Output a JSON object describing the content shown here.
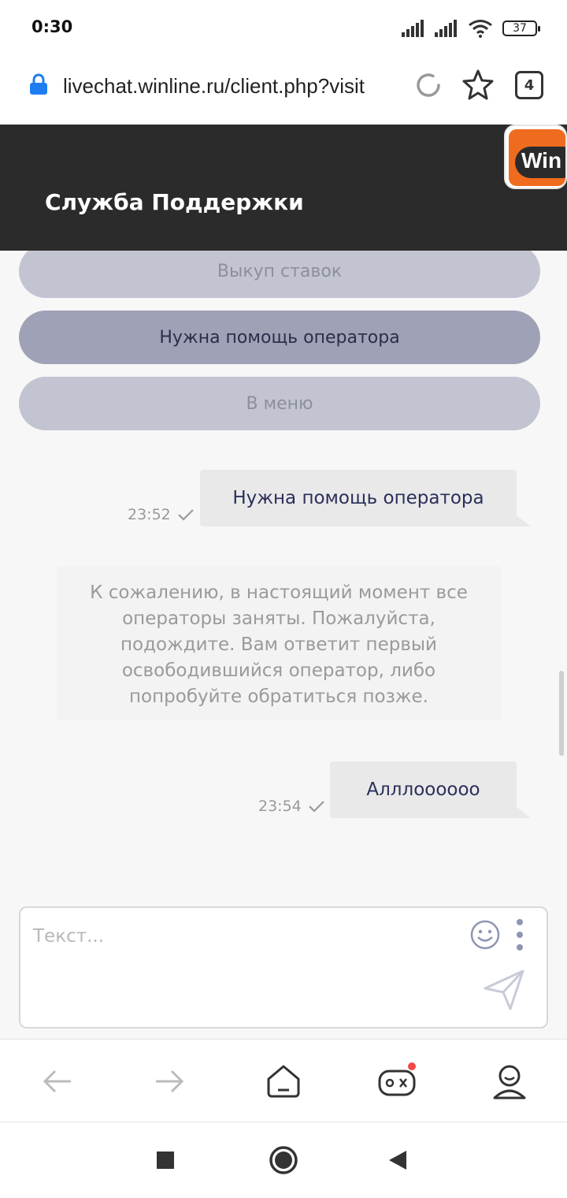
{
  "status_bar": {
    "time": "0:30",
    "battery": "37"
  },
  "browser": {
    "url": "livechat.winline.ru/client.php?visit",
    "tabs_count": "4"
  },
  "chat": {
    "title": "Служба Поддержки",
    "logo_text": "Win",
    "quick_buttons": [
      "Выкуп ставок",
      "Нужна помощь оператора",
      "В меню"
    ],
    "messages": [
      {
        "text": "Нужна помощь оператора",
        "time": "23:52"
      },
      {
        "text": "К сожалению, в настоящий момент все операторы заняты. Пожалуйста, подождите. Вам ответит первый освободившийся оператор, либо попробуйте обратиться позже."
      },
      {
        "text": "Алллоооооо",
        "time": "23:54"
      }
    ],
    "input": {
      "placeholder": "Текст...",
      "value": ""
    }
  },
  "colors": {
    "header_bg": "#2b2b2b",
    "accent_orange": "#ef6c1f",
    "quick_btn": "#c2c4d2",
    "quick_btn_active": "#9fa1b6",
    "notification_dot": "#f04848"
  },
  "icons": [
    "lock-icon",
    "reload-icon",
    "star-icon",
    "smiley-icon",
    "more-icon",
    "send-icon",
    "back-icon",
    "forward-icon",
    "home-icon",
    "games-icon",
    "profile-icon",
    "recents-icon",
    "home-circle-icon",
    "back-triangle-icon"
  ]
}
